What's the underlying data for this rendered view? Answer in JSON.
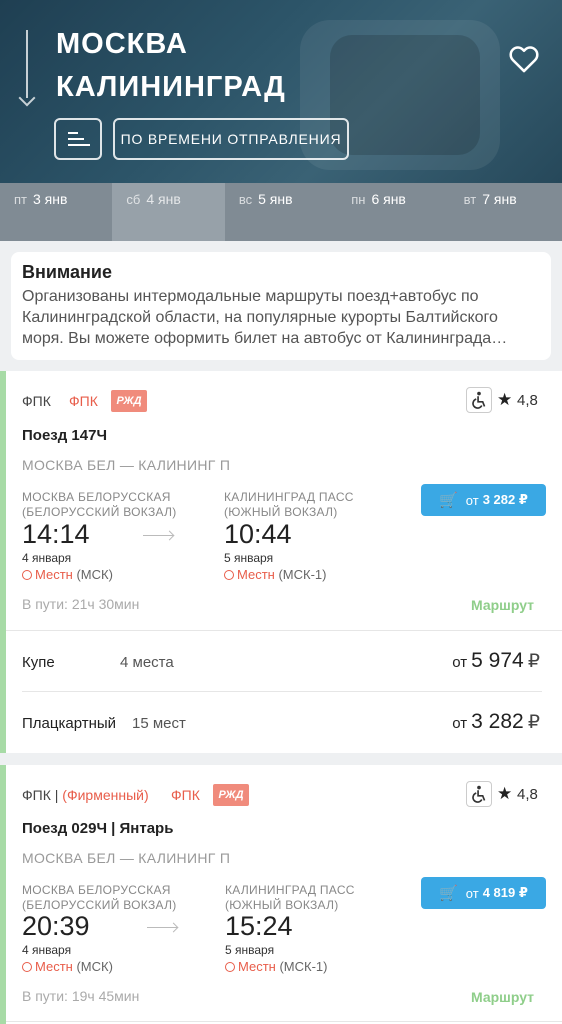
{
  "header": {
    "from_city": "МОСКВА",
    "to_city": "КАЛИНИНГРАД",
    "sort_button_label": "ПО ВРЕМЕНИ ОТПРАВЛЕНИЯ"
  },
  "dates": [
    {
      "weekday": "пт",
      "date": "3 янв",
      "active": false
    },
    {
      "weekday": "сб",
      "date": "4 янв",
      "active": true
    },
    {
      "weekday": "вс",
      "date": "5 янв",
      "active": false
    },
    {
      "weekday": "пн",
      "date": "6 янв",
      "active": false
    },
    {
      "weekday": "вт",
      "date": "7 янв",
      "active": false
    }
  ],
  "notice": {
    "title": "Внимание",
    "text": "Организованы интермодальные маршруты поезд+автобус по Калининградской области, на популярные курорты Балтийского моря. Вы можете оформить билет на автобус от Калининграда…"
  },
  "trains": [
    {
      "carrier": "ФПК",
      "carrier_brand": "",
      "carrier_logo_text": "ФПК",
      "rzd_logo": "РЖД",
      "rating": "4,8",
      "name": "Поезд 147Ч",
      "route": "МОСКВА БЕЛ — КАЛИНИНГ П",
      "dep_station_line1": "МОСКВА БЕЛОРУССКАЯ",
      "dep_station_line2": "(БЕЛОРУССКИЙ ВОКЗАЛ)",
      "arr_station_line1": "КАЛИНИНГРАД ПАСС",
      "arr_station_line2": "(ЮЖНЫЙ ВОКЗАЛ)",
      "dep_time": "14:14",
      "arr_time": "10:44",
      "dep_date": "4 января",
      "arr_date": "5 января",
      "dep_tz_label": "Местн",
      "dep_tz": "(МСК)",
      "arr_tz_label": "Местн",
      "arr_tz": "(МСК-1)",
      "price_prefix": "от",
      "price": "3 282 ₽",
      "duration": "В пути: 21ч 30мин",
      "route_link": "Маршрут",
      "classes": [
        {
          "name": "Купе",
          "seats": "4 места",
          "prefix": "от",
          "price": "5 974",
          "currency": "₽"
        },
        {
          "name": "Плацкартный",
          "seats": "15 мест",
          "prefix": "от",
          "price": "3 282",
          "currency": "₽"
        }
      ]
    },
    {
      "carrier": "ФПК |",
      "carrier_brand": "(Фирменный)",
      "carrier_logo_text": "ФПК",
      "rzd_logo": "РЖД",
      "rating": "4,8",
      "name": "Поезд 029Ч | Янтарь",
      "route": "МОСКВА БЕЛ — КАЛИНИНГ П",
      "dep_station_line1": "МОСКВА БЕЛОРУССКАЯ",
      "dep_station_line2": "(БЕЛОРУССКИЙ ВОКЗАЛ)",
      "arr_station_line1": "КАЛИНИНГРАД ПАСС",
      "arr_station_line2": "(ЮЖНЫЙ ВОКЗАЛ)",
      "dep_time": "20:39",
      "arr_time": "15:24",
      "dep_date": "4 января",
      "arr_date": "5 января",
      "dep_tz_label": "Местн",
      "dep_tz": "(МСК)",
      "arr_tz_label": "Местн",
      "arr_tz": "(МСК-1)",
      "price_prefix": "от",
      "price": "4 819 ₽",
      "duration": "В пути: 19ч 45мин",
      "route_link": "Маршрут"
    }
  ]
}
